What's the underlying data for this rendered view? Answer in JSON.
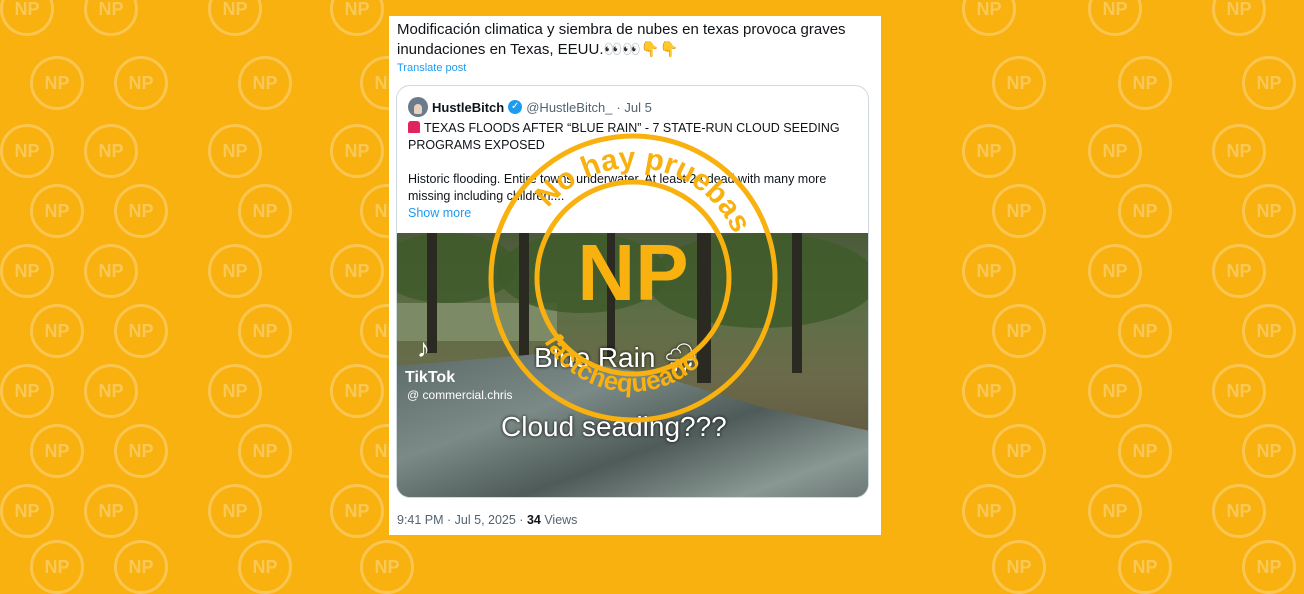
{
  "watermark_text": "NP",
  "colors": {
    "background": "#f8b10e",
    "stamp": "#f8b10e",
    "link": "#1d9bf0"
  },
  "post": {
    "text": "Modificación climatica y siembra de nubes en texas provoca graves inundaciones en Texas, EEUU.👀👀👇👇",
    "translate_label": "Translate post",
    "time": "9:41 PM · Jul 5, 2025 · ",
    "views_count": "34",
    "views_label": " Views"
  },
  "quote": {
    "author_name": "HustleBitch",
    "handle": "@HustleBitch_",
    "date": "· Jul 5",
    "headline": "TEXAS FLOODS AFTER “BLUE RAIN” -  7 STATE-RUN CLOUD SEEDING PROGRAMS EXPOSED",
    "body": "Historic flooding. Entire towns underwater. At least 24 dead with many more missing including children....",
    "show_more": "Show more",
    "icons": {
      "verified": "verified-badge-icon",
      "siren": "siren-icon",
      "tiktok": "tiktok-logo-icon"
    }
  },
  "media": {
    "tiktok_label": "TikTok",
    "tiktok_handle": "@ commercial.chris",
    "caption_1": "Blue Rain 🌧",
    "caption_2": "Cloud seading???"
  },
  "stamp": {
    "top_text": "No hay pruebas",
    "center_text": "NP",
    "bottom_text": "factchequeado"
  }
}
